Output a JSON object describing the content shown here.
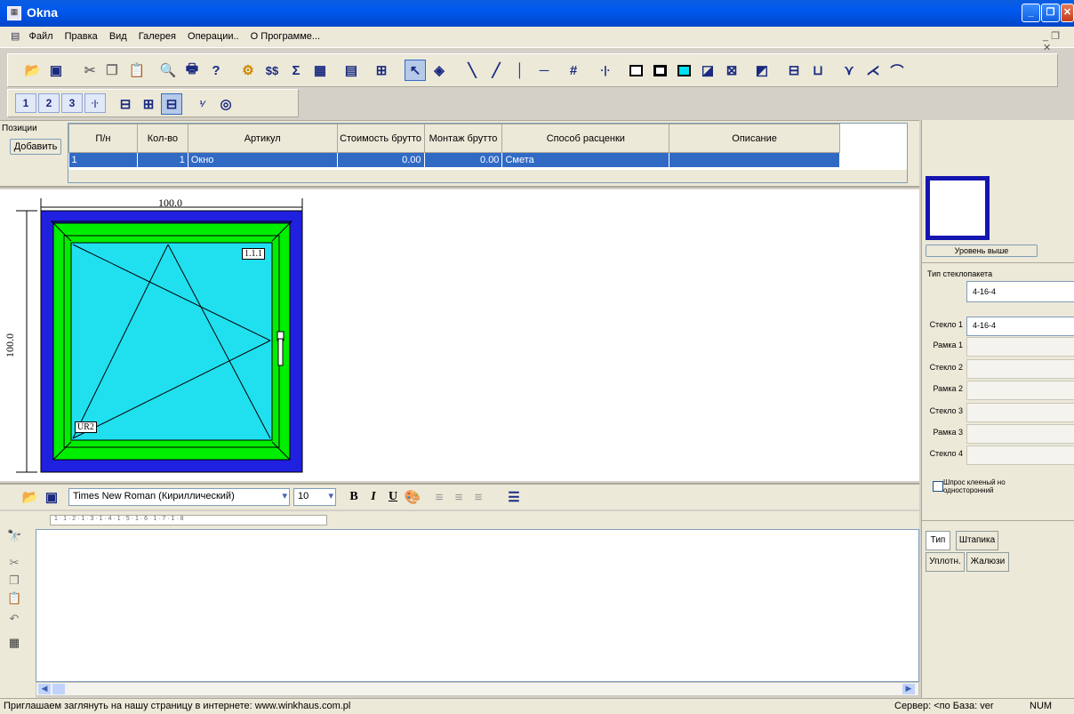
{
  "window": {
    "title": "Okna"
  },
  "menu": {
    "items": [
      "Файл",
      "Правка",
      "Вид",
      "Галерея",
      "Операции..",
      "О Программе..."
    ]
  },
  "positions": {
    "label": "Позиции",
    "add_button": "Добавить",
    "columns": [
      "П/н",
      "Кол-во",
      "Артикул",
      "Стоимость брутто",
      "Монтаж брутто",
      "Способ расценки",
      "Описание"
    ],
    "rows": [
      [
        "1",
        "1",
        "Окно",
        "0.00",
        "0.00",
        "Смета",
        ""
      ]
    ]
  },
  "drawing": {
    "width_label": "100.0",
    "height_label": "100.0",
    "sash_label": "1.1.1",
    "corner_label": "UR2",
    "colors": {
      "outer_frame": "#2020e0",
      "frame": "#00ee00",
      "glass": "#20e0f0"
    }
  },
  "editor": {
    "font": "Times New Roman (Кириллический)",
    "size": "10",
    "ruler": "1 · 1 · 2 · 1 · 3 · 1 · 4 · 1 · 5 · 1 · 6 · 1 · 7 · 1 · 8",
    "bold_label": "B",
    "italic_label": "I",
    "underline_label": "U"
  },
  "side_panel": {
    "level_up_button": "Уровень выше",
    "glass_type_label": "Тип стеклопакета",
    "glass_type_value": "4-16-4",
    "fields": [
      {
        "label": "Стекло 1",
        "value": "4-16-4"
      },
      {
        "label": "Рамка 1",
        "value": ""
      },
      {
        "label": "Стекло 2",
        "value": ""
      },
      {
        "label": "Рамка 2",
        "value": ""
      },
      {
        "label": "Стекло 3",
        "value": ""
      },
      {
        "label": "Рамка 3",
        "value": ""
      },
      {
        "label": "Стекло 4",
        "value": ""
      }
    ],
    "checkbox_label": "Шпрос клееный но односторонний",
    "tabs": [
      "Тип",
      "Штапика",
      "Уплотн.",
      "Жалюзи"
    ]
  },
  "status": {
    "message": "Приглашаем заглянуть на нашу страницу в интернете: www.winkhaus.com.pl",
    "server": "Сервер: <по База: ver",
    "num": "NUM"
  }
}
